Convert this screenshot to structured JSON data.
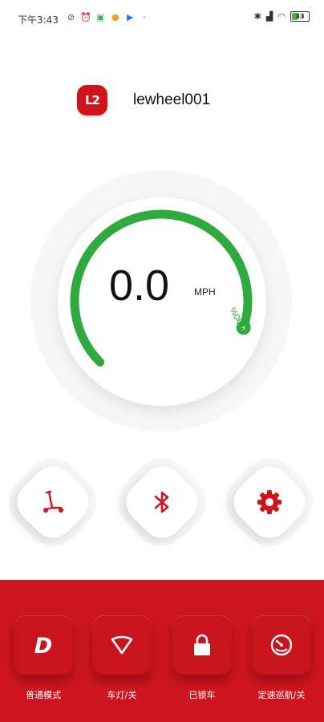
{
  "status_bar": {
    "time": "下午3:43",
    "battery_level": "33",
    "battery_fraction": 0.33
  },
  "device": {
    "logo_text": "L2",
    "name": "lewheel001"
  },
  "gauge": {
    "speed": "0.0",
    "unit": "MPH",
    "battery_text": "%06",
    "battery_fraction": 0.9,
    "arc_color": "#2eaa3f"
  },
  "round_buttons": [
    {
      "name": "scooter",
      "icon": "scooter-icon"
    },
    {
      "name": "bluetooth",
      "icon": "bluetooth-icon"
    },
    {
      "name": "settings",
      "icon": "gear-icon"
    }
  ],
  "controls": {
    "mode_label": "普通模式",
    "light_label": "车灯/关",
    "lock_label": "已锁车",
    "cruise_label": "定速巡航/关"
  },
  "colors": {
    "brand_red": "#d0141c",
    "panel_red": "#cf1620",
    "green": "#2eaa3f"
  }
}
